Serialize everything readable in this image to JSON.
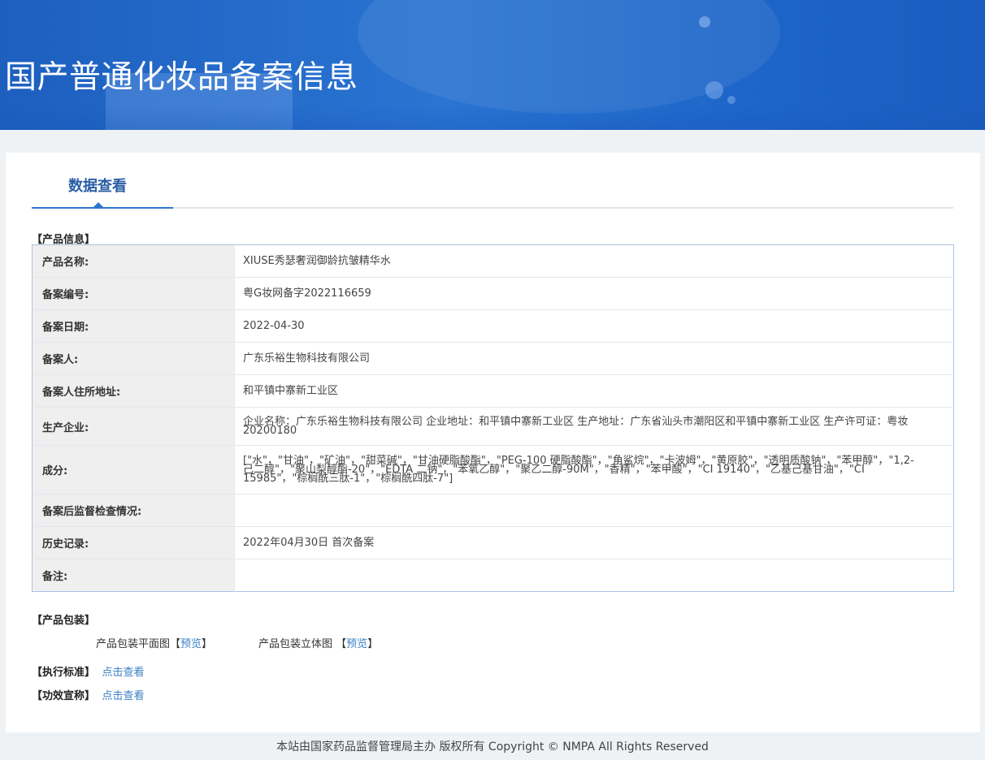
{
  "banner": {
    "title": "国产普通化妆品备案信息"
  },
  "tab": {
    "label": "数据查看"
  },
  "product_section": {
    "label": "【产品信息】"
  },
  "rows": [
    {
      "key": "产品名称:",
      "value": "XIUSE秀瑟奢润御龄抗皱精华水"
    },
    {
      "key": "备案编号:",
      "value": "粤G妆网备字2022116659"
    },
    {
      "key": "备案日期:",
      "value": "2022-04-30"
    },
    {
      "key": "备案人:",
      "value": "广东乐裕生物科技有限公司"
    },
    {
      "key": "备案人住所地址:",
      "value": "和平镇中寨新工业区"
    },
    {
      "key": "生产企业:",
      "value": "企业名称：广东乐裕生物科技有限公司 企业地址：和平镇中寨新工业区 生产地址：广东省汕头市潮阳区和平镇中寨新工业区 生产许可证：粤妆20200180"
    },
    {
      "key": "成分:",
      "value": "[\"水\"，\"甘油\"，\"矿油\"，\"甜菜碱\"，\"甘油硬脂酸酯\"，\"PEG-100 硬脂酸酯\"，\"角鲨烷\"，\"卡波姆\"，\"黄原胶\"，\"透明质酸钠\"，\"苯甲醇\"，\"1,2-己二醇\"，\"聚山梨醇酯-20\"，\"EDTA 二钠\"，\"苯氧乙醇\"，\"聚乙二醇-90M\"，\"香精\"，\"苯甲酸\"，\"CI 19140\"，\"乙基己基甘油\"，\"CI 15985\"，\"棕榈酰三肽-1\"，\"棕榈酰四肽-7\"]"
    },
    {
      "key": "备案后监督检查情况:",
      "value": ""
    },
    {
      "key": "历史记录:",
      "value": "2022年04月30日 首次备案"
    },
    {
      "key": "备注:",
      "value": ""
    }
  ],
  "package_section": {
    "label": "【产品包装】",
    "flat_label": "产品包装平面图",
    "solid_label": "产品包装立体图",
    "bracket_open": "【",
    "bracket_close": "】",
    "preview": "预览"
  },
  "standard": {
    "label": "【执行标准】",
    "link": "点击查看"
  },
  "efficacy": {
    "label": "【功效宣称】",
    "link": "点击查看"
  },
  "footer": {
    "text": "本站由国家药品监督管理局主办 版权所有 Copyright © NMPA All Rights Reserved"
  }
}
